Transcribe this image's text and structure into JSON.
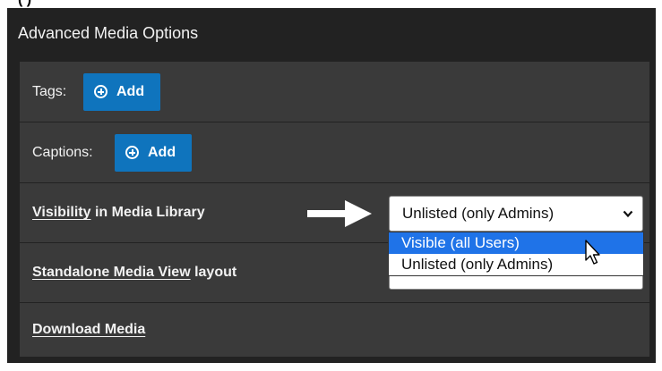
{
  "fragment_top_text": "(    )",
  "panel": {
    "title": "Advanced Media Options",
    "rows": {
      "tags": {
        "label": "Tags:",
        "button": "Add"
      },
      "captions": {
        "label": "Captions:",
        "button": "Add"
      },
      "visibility": {
        "label_link": "Visibility",
        "label_rest": " in Media Library",
        "selected_value": "Unlisted (only Admins)",
        "options": [
          "Visible (all Users)",
          "Unlisted (only Admins)"
        ],
        "highlighted_option": "Visible (all Users)"
      },
      "standalone": {
        "label_link": "Standalone Media View",
        "label_rest": " layout"
      },
      "download": {
        "label_link": "Download Media"
      }
    }
  },
  "colors": {
    "panel_bg": "#222222",
    "row_bg": "#3a3a3a",
    "button_blue": "#0f74bd",
    "option_highlight": "#1f73e8"
  },
  "icons": [
    "plus-circle-icon",
    "right-arrow-icon",
    "chevron-down-icon",
    "mouse-pointer-icon"
  ]
}
